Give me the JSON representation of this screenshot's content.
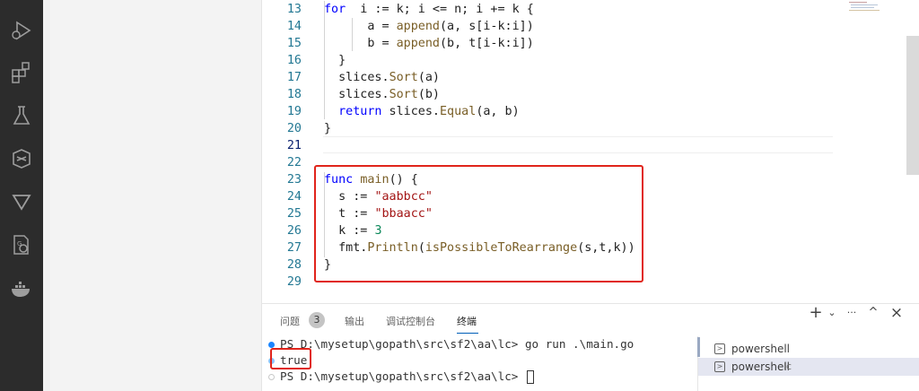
{
  "activity_bar": {
    "icons": [
      "run-debug-icon",
      "extensions-icon",
      "testing-icon",
      "remote-explorer-icon",
      "flow-icon",
      "settings-sync-icon",
      "docker-icon"
    ]
  },
  "editor": {
    "lines": [
      {
        "n": "13",
        "tokens": [
          [
            "kw",
            "for"
          ],
          [
            "",
            "  i := k; i <= n; i += k {"
          ]
        ]
      },
      {
        "n": "14",
        "tokens": [
          [
            "",
            "      a = "
          ],
          [
            "fn",
            "append"
          ],
          [
            "",
            "(a, s[i-k:i])"
          ]
        ]
      },
      {
        "n": "15",
        "tokens": [
          [
            "",
            "      b = "
          ],
          [
            "fn",
            "append"
          ],
          [
            "",
            "(b, t[i-k:i])"
          ]
        ]
      },
      {
        "n": "16",
        "tokens": [
          [
            "",
            "  }"
          ]
        ]
      },
      {
        "n": "17",
        "tokens": [
          [
            "",
            "  slices."
          ],
          [
            "fn",
            "Sort"
          ],
          [
            "",
            "(a)"
          ]
        ]
      },
      {
        "n": "18",
        "tokens": [
          [
            "",
            "  slices."
          ],
          [
            "fn",
            "Sort"
          ],
          [
            "",
            "(b)"
          ]
        ]
      },
      {
        "n": "19",
        "tokens": [
          [
            "kw",
            "  return"
          ],
          [
            "",
            " slices."
          ],
          [
            "fn",
            "Equal"
          ],
          [
            "",
            "(a, b)"
          ]
        ]
      },
      {
        "n": "20",
        "tokens": [
          [
            "",
            "}"
          ]
        ]
      },
      {
        "n": "21",
        "tokens": []
      },
      {
        "n": "22",
        "tokens": []
      },
      {
        "n": "23",
        "tokens": [
          [
            "kw",
            "func"
          ],
          [
            "",
            " "
          ],
          [
            "fn",
            "main"
          ],
          [
            "",
            "() {"
          ]
        ]
      },
      {
        "n": "24",
        "tokens": [
          [
            "",
            "  s := "
          ],
          [
            "str",
            "\"aabbcc\""
          ]
        ]
      },
      {
        "n": "25",
        "tokens": [
          [
            "",
            "  t := "
          ],
          [
            "str",
            "\"bbaacc\""
          ]
        ]
      },
      {
        "n": "26",
        "tokens": [
          [
            "",
            "  k := "
          ],
          [
            "num",
            "3"
          ]
        ]
      },
      {
        "n": "27",
        "tokens": [
          [
            "",
            "  fmt."
          ],
          [
            "fn",
            "Println"
          ],
          [
            "",
            "("
          ],
          [
            "fn",
            "isPossibleToRearrange"
          ],
          [
            "",
            "(s,t,k))"
          ]
        ]
      },
      {
        "n": "28",
        "tokens": [
          [
            "",
            "}"
          ]
        ]
      },
      {
        "n": "29",
        "tokens": []
      }
    ],
    "active_line": "21"
  },
  "panel": {
    "tabs": {
      "problems": "问题",
      "problems_count": "3",
      "output": "输出",
      "debug_console": "调试控制台",
      "terminal": "终端"
    },
    "actions": {
      "add": "+",
      "dropdown": "⌄",
      "more": "···",
      "maximize": "^",
      "close": "×"
    },
    "terminal_lines": [
      "PS D:\\mysetup\\gopath\\src\\sf2\\aa\\lc> go run .\\main.go",
      "true",
      "PS D:\\mysetup\\gopath\\src\\sf2\\aa\\lc> "
    ],
    "terminal_list": [
      {
        "name": "powershell",
        "sub": ""
      },
      {
        "name": "powershell",
        "sub": "lc"
      }
    ]
  },
  "colors": {
    "highlight_box": "#e0241b",
    "activity_bar": "#2c2c2c",
    "line_number": "#237893",
    "keyword": "#0000ff",
    "string": "#a31515"
  }
}
